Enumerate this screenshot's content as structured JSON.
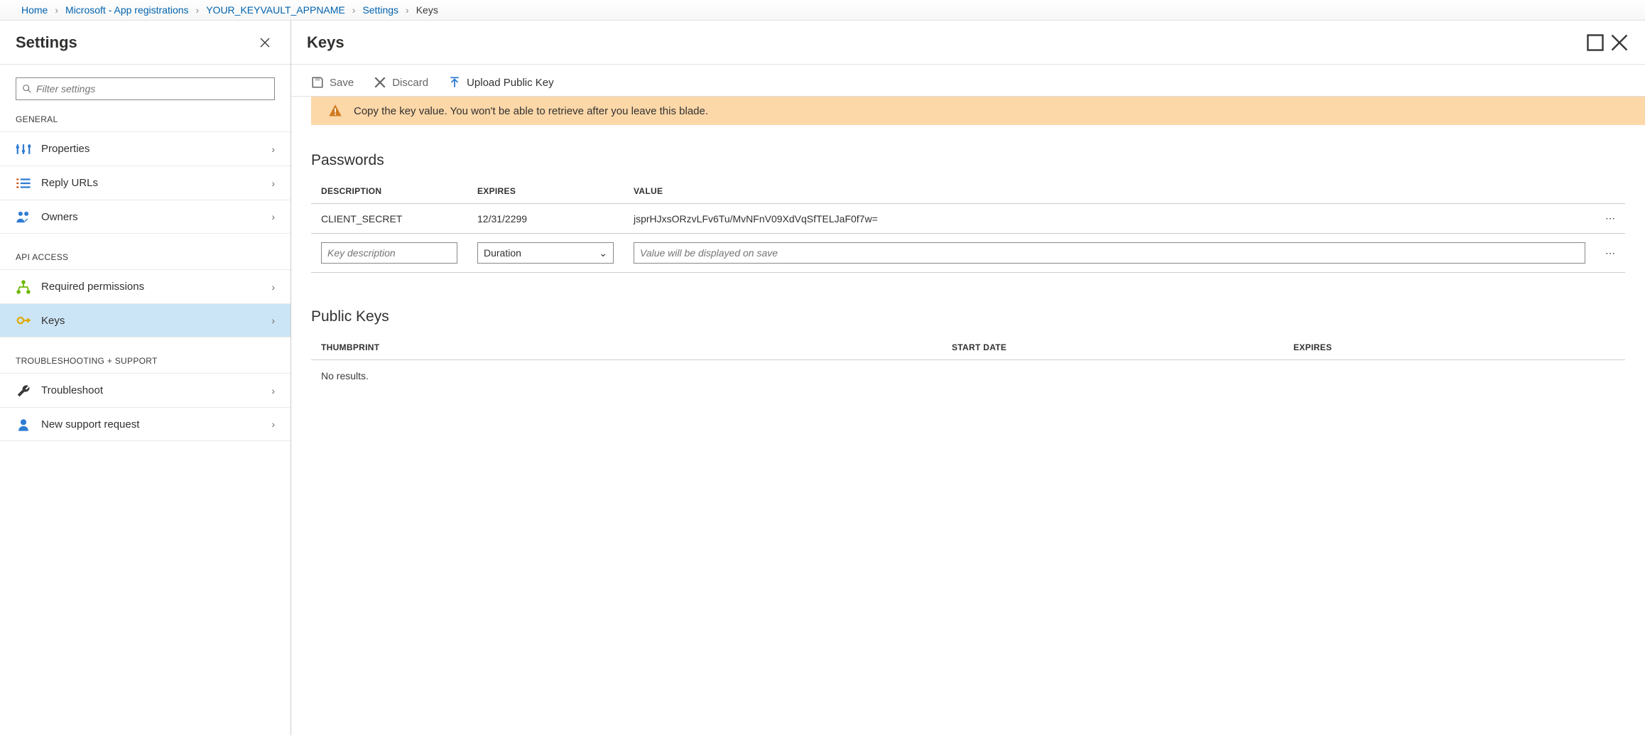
{
  "breadcrumb": {
    "home": "Home",
    "appreg": "Microsoft - App registrations",
    "app": "YOUR_KEYVAULT_APPNAME",
    "settings": "Settings",
    "keys": "Keys"
  },
  "settings_blade": {
    "title": "Settings",
    "filter_placeholder": "Filter settings",
    "groups": {
      "general": {
        "label": "GENERAL",
        "items": {
          "properties": "Properties",
          "reply_urls": "Reply URLs",
          "owners": "Owners"
        }
      },
      "api_access": {
        "label": "API ACCESS",
        "items": {
          "required_permissions": "Required permissions",
          "keys": "Keys"
        }
      },
      "troubleshooting": {
        "label": "TROUBLESHOOTING + SUPPORT",
        "items": {
          "troubleshoot": "Troubleshoot",
          "new_support_request": "New support request"
        }
      }
    }
  },
  "keys_blade": {
    "title": "Keys",
    "cmd": {
      "save": "Save",
      "discard": "Discard",
      "upload": "Upload Public Key"
    },
    "banner": "Copy the key value. You won't be able to retrieve after you leave this blade.",
    "passwords": {
      "heading": "Passwords",
      "headers": {
        "description": "DESCRIPTION",
        "expires": "EXPIRES",
        "value": "VALUE"
      },
      "rows": [
        {
          "description": "CLIENT_SECRET",
          "expires": "12/31/2299",
          "value": "jsprHJxsORzvLFv6Tu/MvNFnV09XdVqSfTELJaF0f7w="
        }
      ],
      "new_row": {
        "description_placeholder": "Key description",
        "duration_label": "Duration",
        "value_placeholder": "Value will be displayed on save"
      }
    },
    "public_keys": {
      "heading": "Public Keys",
      "headers": {
        "thumbprint": "THUMBPRINT",
        "start_date": "START DATE",
        "expires": "EXPIRES"
      },
      "no_results": "No results."
    }
  }
}
